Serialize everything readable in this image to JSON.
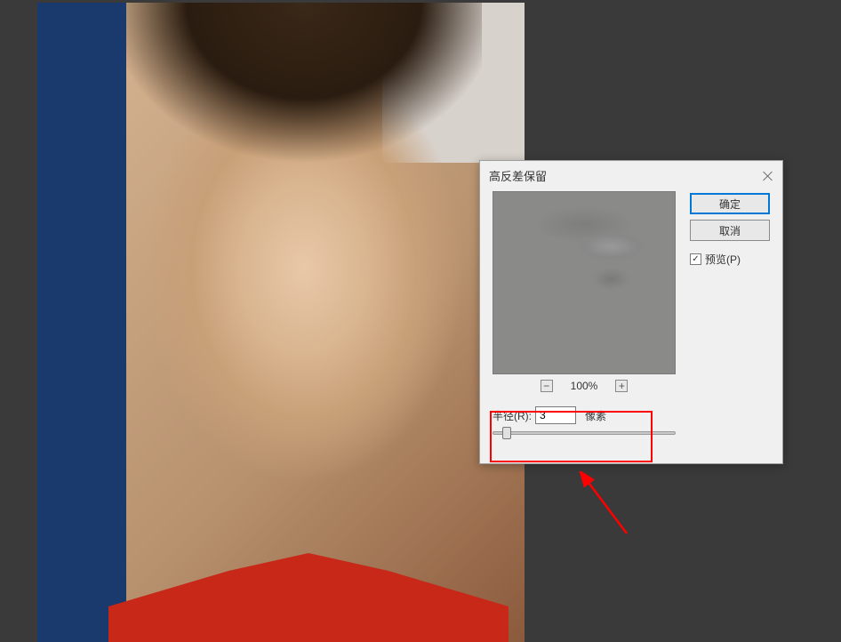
{
  "dialog": {
    "title": "高反差保留",
    "zoom_level": "100%",
    "radius_label": "半径(R):",
    "radius_value": "3",
    "radius_unit": "像素",
    "ok_label": "确定",
    "cancel_label": "取消",
    "preview_label": "预览(P)",
    "preview_checked": true
  }
}
